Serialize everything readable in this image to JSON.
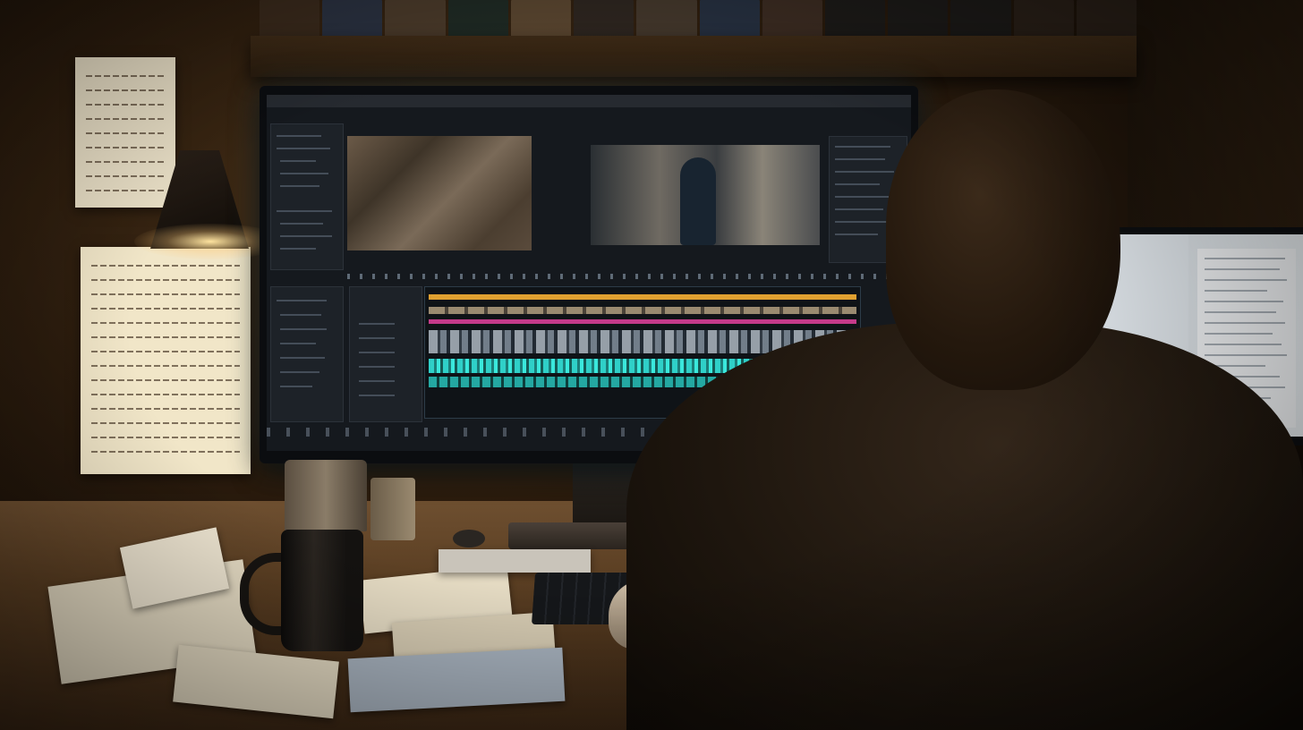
{
  "scene": {
    "description_tags": [
      "video-editing-workstation",
      "night",
      "desk"
    ],
    "accent_colors": {
      "timeline_audio": "#2fd0c8",
      "timeline_video": "#c43a8a",
      "timeline_title": "#e0a030",
      "lamp_light": "#ffe4a0"
    }
  },
  "monitor": {
    "panels": [
      "project-panel",
      "source-monitor",
      "program-monitor",
      "effects-panel",
      "timeline-panel"
    ]
  },
  "icons": [
    "lamp-icon",
    "mug-icon",
    "keyboard-icon"
  ]
}
